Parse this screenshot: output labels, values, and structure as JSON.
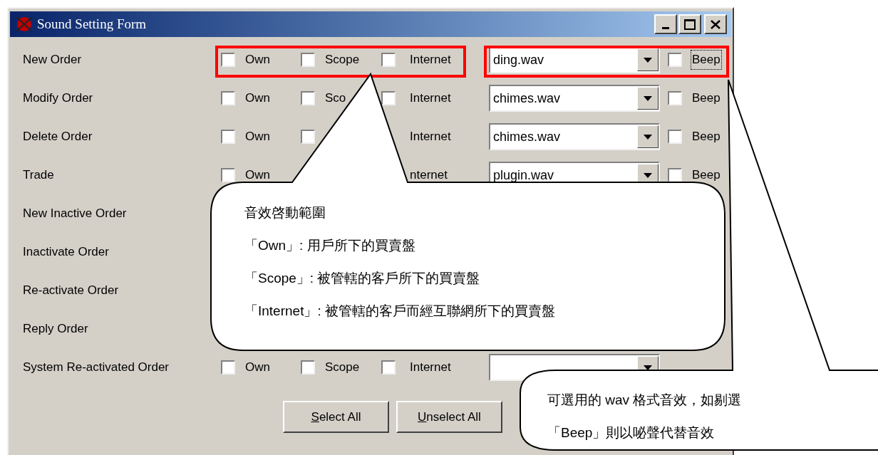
{
  "window": {
    "title": "Sound Setting Form"
  },
  "rows": [
    {
      "label": "New Order",
      "own": {
        "label": "Own",
        "checked": false
      },
      "scope": {
        "label": "Scope",
        "checked": false
      },
      "internet": {
        "label": "Internet",
        "checked": false
      },
      "sound": {
        "value": "ding.wav"
      },
      "beep": {
        "label": "Beep",
        "checked": false,
        "focused": true
      }
    },
    {
      "label": "Modify Order",
      "own": {
        "label": "Own",
        "checked": false
      },
      "scope": {
        "label": "Sco",
        "checked": false
      },
      "internet": {
        "label": "Internet",
        "checked": false
      },
      "sound": {
        "value": "chimes.wav"
      },
      "beep": {
        "label": "Beep",
        "checked": false,
        "focused": false
      }
    },
    {
      "label": "Delete Order",
      "own": {
        "label": "Own",
        "checked": false
      },
      "scope": {
        "checked": false
      },
      "internet": {
        "label": "Internet"
      },
      "sound": {
        "value": "chimes.wav"
      },
      "beep": {
        "label": "Beep",
        "checked": false,
        "focused": false
      }
    },
    {
      "label": "Trade",
      "own": {
        "label": "Own",
        "checked": false
      },
      "internet": {
        "label": "nternet"
      },
      "sound": {
        "value": "plugin.wav"
      },
      "beep": {
        "label": "Beep",
        "checked": false,
        "focused": false
      }
    },
    {
      "label": "New Inactive Order"
    },
    {
      "label": "Inactivate Order"
    },
    {
      "label": "Re-activate Order"
    },
    {
      "label": "Reply Order"
    },
    {
      "label": "System Re-activated Order",
      "own": {
        "label": "Own",
        "checked": false
      },
      "scope": {
        "label": "Scope",
        "checked": false
      },
      "internet": {
        "label": "Internet",
        "checked": false
      },
      "sound": {}
    }
  ],
  "buttons": [
    {
      "access_key": "S",
      "label_rest": "elect All"
    },
    {
      "access_key": "U",
      "label_rest": "nselect All"
    }
  ],
  "callouts": [
    {
      "lines": [
        "音效啓動範圍",
        "「Own」: 用戶所下的買賣盤",
        "「Scope」: 被管轄的客戶所下的買賣盤",
        "「Internet」: 被管轄的客戶而經互聯網所下的買賣盤"
      ]
    },
    {
      "lines": [
        "可選用的 wav 格式音效，如剔選",
        "「Beep」則以咇聲代替音效"
      ]
    }
  ]
}
